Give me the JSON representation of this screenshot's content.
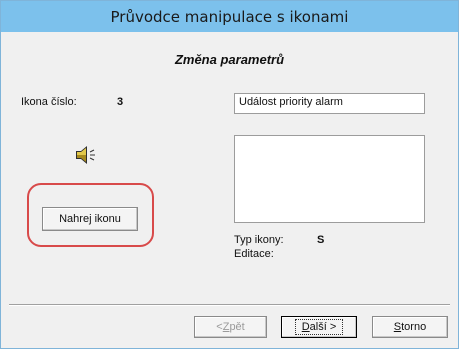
{
  "window": {
    "title": "Průvodce manipulace s ikonami"
  },
  "heading": "Změna parametrů",
  "icon_number": {
    "label": "Ikona číslo:",
    "value": "3"
  },
  "name_field": {
    "value": "Událost priority alarm"
  },
  "description_field": {
    "value": ""
  },
  "icon_preview": {
    "icon": "speaker-sound-icon"
  },
  "load_button": {
    "label": "Nahrej ikonu"
  },
  "icon_type": {
    "label": "Typ ikony:",
    "value": "S"
  },
  "edit": {
    "label": "Editace:"
  },
  "nav": {
    "back": {
      "prefix": "< ",
      "hotkey": "Z",
      "rest": "pět"
    },
    "next": {
      "hotkey": "D",
      "rest": "alší",
      "suffix": " >"
    },
    "cancel": {
      "hotkey": "S",
      "rest": "torno"
    }
  },
  "colors": {
    "titlebar": "#7cc1ec",
    "highlight": "#d84a4a"
  }
}
